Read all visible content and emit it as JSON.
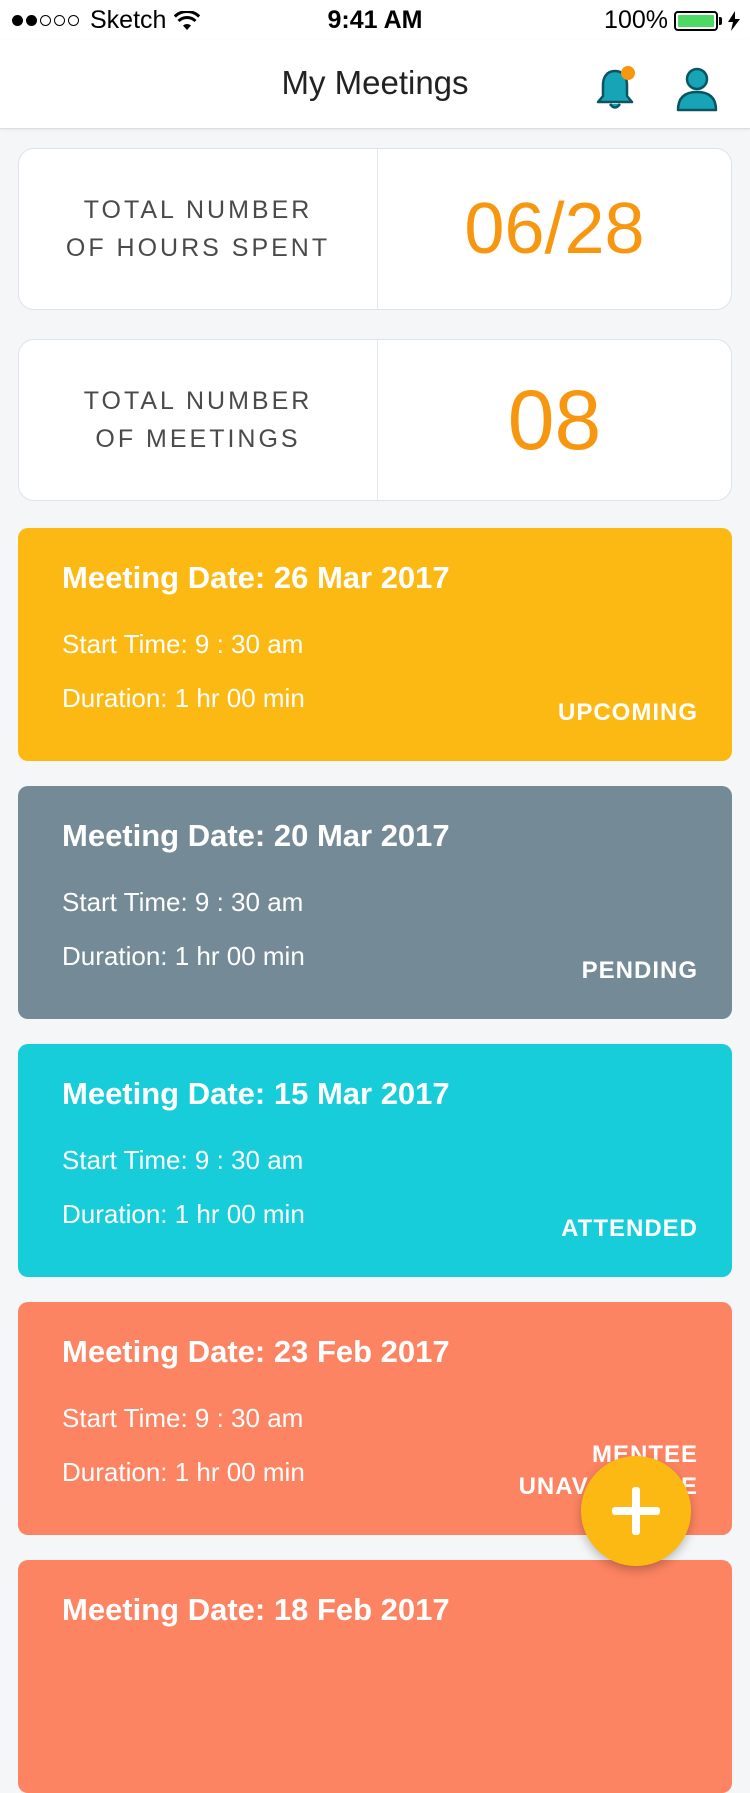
{
  "status_bar": {
    "carrier": "Sketch",
    "time": "9:41 AM",
    "battery": "100%"
  },
  "nav": {
    "title": "My Meetings",
    "notification_icon": "bell-icon",
    "profile_icon": "user-icon"
  },
  "stats": [
    {
      "label_line1": "TOTAL NUMBER",
      "label_line2": "OF HOURS SPENT",
      "value": "06/28"
    },
    {
      "label_line1": "TOTAL NUMBER",
      "label_line2": "OF MEETINGS",
      "value": "08"
    }
  ],
  "meetings": [
    {
      "date": "Meeting Date: 26 Mar 2017",
      "start": "Start Time: 9 : 30 am",
      "duration": "Duration: 1 hr 00 min",
      "status": "UPCOMING",
      "color": "#fdb913"
    },
    {
      "date": "Meeting Date: 20 Mar 2017",
      "start": "Start Time: 9 : 30 am",
      "duration": "Duration: 1 hr 00 min",
      "status": "PENDING",
      "color": "#748a96"
    },
    {
      "date": "Meeting Date: 15 Mar 2017",
      "start": "Start Time: 9 : 30 am",
      "duration": "Duration: 1 hr 00 min",
      "status": "ATTENDED",
      "color": "#17cdd9"
    },
    {
      "date": "Meeting Date: 23 Feb 2017",
      "start": "Start Time: 9 : 30 am",
      "duration": "Duration: 1 hr 00 min",
      "status_line1": "MENTEE",
      "status_line2": "UNAVAILABLE",
      "color": "#fc8462"
    },
    {
      "date": "Meeting Date: 18 Feb 2017",
      "color": "#fc8462"
    }
  ],
  "colors": {
    "accent_orange": "#f7960f",
    "icon_teal": "#17a4b6",
    "notification_dot": "#f7960f",
    "fab": "#fdb913"
  },
  "fab_icon": "plus-icon"
}
